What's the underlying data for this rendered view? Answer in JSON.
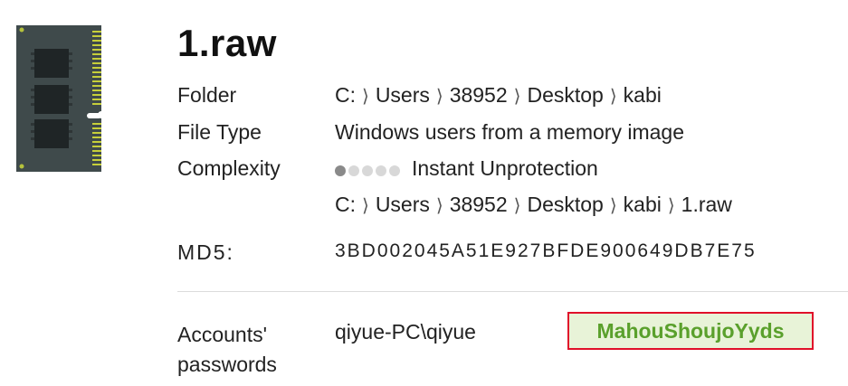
{
  "file": {
    "title": "1.raw"
  },
  "rows": {
    "folder": {
      "label": "Folder",
      "crumbs": [
        "C:",
        "Users",
        "38952",
        "Desktop",
        "kabi"
      ]
    },
    "file_type": {
      "label": "File Type",
      "value": "Windows users from a memory image"
    },
    "complexity": {
      "label": "Complexity",
      "value": "Instant Unprotection",
      "level": 1,
      "max": 5
    },
    "path": {
      "crumbs": [
        "C:",
        "Users",
        "38952",
        "Desktop",
        "kabi",
        "1.raw"
      ]
    },
    "md5": {
      "label": "MD5:",
      "value": "3BD002045A51E927BFDE900649DB7E75"
    }
  },
  "accounts": {
    "label_line1": "Accounts'",
    "label_line2": "passwords",
    "user": "qiyue-PC\\qiyue",
    "password": "MahouShoujoYyds"
  },
  "icons": {
    "file_icon": "memory-module-icon",
    "separator": "chevron-right-icon"
  },
  "colors": {
    "password_text": "#5aa02c",
    "password_bg": "#e8f3d8",
    "highlight_border": "#e0102a"
  }
}
